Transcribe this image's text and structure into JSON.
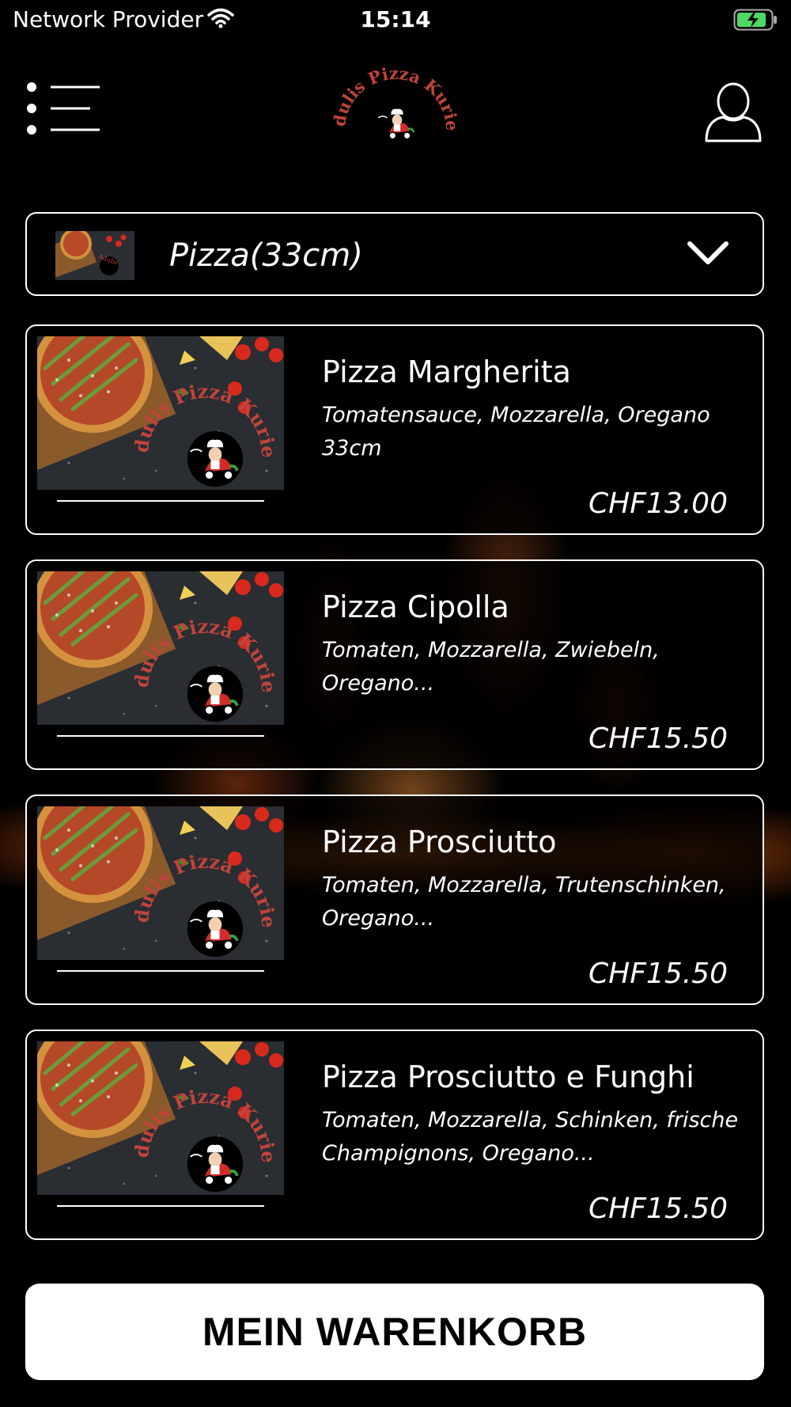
{
  "status_bar": {
    "carrier": "Network Provider",
    "time": "15:14"
  },
  "brand": {
    "name": "Adulis Pizza Kurier",
    "accent_color": "#c0443a"
  },
  "header": {
    "menu_icon": "menu-list-icon",
    "profile_icon": "user-profile-icon"
  },
  "category": {
    "selected": "Pizza(33cm)",
    "chevron_icon": "chevron-down-icon"
  },
  "products": [
    {
      "name": "Pizza Margherita",
      "description": "Tomatensauce, Mozzarella, Oregano 33cm",
      "price": "CHF13.00"
    },
    {
      "name": "Pizza Cipolla",
      "description": "Tomaten, Mozzarella, Zwiebeln, Oregano...",
      "price": "CHF15.50"
    },
    {
      "name": "Pizza Prosciutto",
      "description": "Tomaten, Mozzarella, Trutenschinken, Oregano...",
      "price": "CHF15.50"
    },
    {
      "name": "Pizza Prosciutto e Funghi",
      "description": "Tomaten, Mozzarella, Schinken, frische Champignons, Oregano...",
      "price": "CHF15.50"
    }
  ],
  "cart": {
    "label": "MEIN WARENKORB"
  }
}
